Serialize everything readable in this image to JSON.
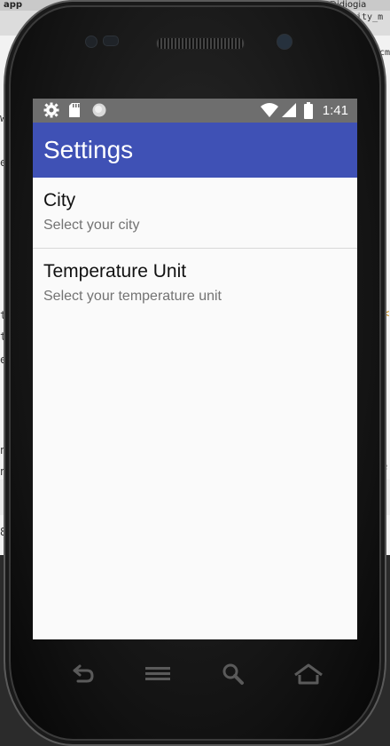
{
  "desktop": {
    "tab_label": "app",
    "tab_right_label": "@idiogia",
    "tab_right_label2": "rity_m",
    "fragments": [
      "w",
      "e",
      "t",
      "t",
      "e",
      "n",
      "n",
      "8",
      "e",
      "cm",
      "<"
    ]
  },
  "statusbar": {
    "time": "1:41",
    "icons": [
      "gear-icon",
      "sd-card-icon",
      "circle-icon",
      "wifi-icon",
      "signal-icon",
      "battery-icon"
    ]
  },
  "toolbar": {
    "title": "Settings",
    "color": "#3f51b5"
  },
  "preferences": [
    {
      "title": "City",
      "summary": "Select your city"
    },
    {
      "title": "Temperature Unit",
      "summary": "Select your temperature unit"
    }
  ],
  "nav_buttons": [
    "back-icon",
    "menu-icon",
    "search-icon",
    "home-icon"
  ]
}
